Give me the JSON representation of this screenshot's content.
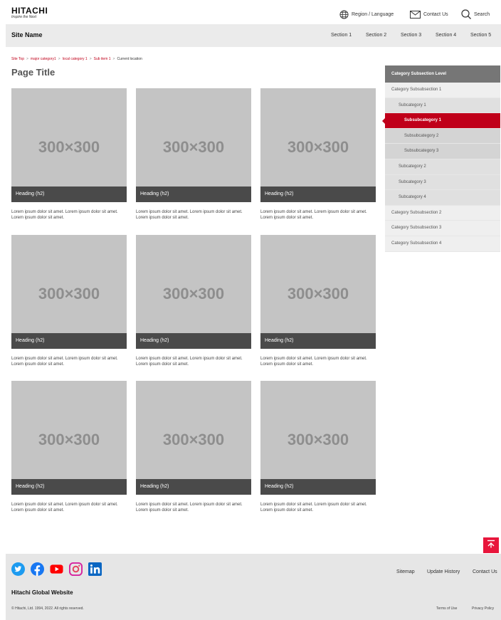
{
  "header": {
    "logo_main": "HITACHI",
    "logo_sub": "Inspire the Next",
    "region_label": "Region / Language",
    "contact_label": "Contact Us",
    "search_label": "Search"
  },
  "sitebar": {
    "site_name": "Site Name",
    "sections": [
      "Section 1",
      "Section 2",
      "Section 3",
      "Section 4",
      "Section 5"
    ]
  },
  "breadcrumb": {
    "items": [
      "Site Top",
      "major category1",
      "local category 1",
      "Sub item 1"
    ],
    "current": "Current location"
  },
  "page": {
    "title": "Page Title",
    "cards": [
      {
        "placeholder": "300×300",
        "heading": "Heading (h2)",
        "text": "Lorem ipsum dolor sit amet. Lorem ipsum dolor sit amet. Lorem ipsum dolor sit amet."
      },
      {
        "placeholder": "300×300",
        "heading": "Heading (h2)",
        "text": "Lorem ipsum dolor sit amet. Lorem ipsum dolor sit amet. Lorem ipsum dolor sit amet."
      },
      {
        "placeholder": "300×300",
        "heading": "Heading (h2)",
        "text": "Lorem ipsum dolor sit amet. Lorem ipsum dolor sit amet. Lorem ipsum dolor sit amet."
      },
      {
        "placeholder": "300×300",
        "heading": "Heading (h2)",
        "text": "Lorem ipsum dolor sit amet. Lorem ipsum dolor sit amet. Lorem ipsum dolor sit amet."
      },
      {
        "placeholder": "300×300",
        "heading": "Heading (h2)",
        "text": "Lorem ipsum dolor sit amet. Lorem ipsum dolor sit amet. Lorem ipsum dolor sit amet."
      },
      {
        "placeholder": "300×300",
        "heading": "Heading (h2)",
        "text": "Lorem ipsum dolor sit amet. Lorem ipsum dolor sit amet. Lorem ipsum dolor sit amet."
      },
      {
        "placeholder": "300×300",
        "heading": "Heading (h2)",
        "text": "Lorem ipsum dolor sit amet. Lorem ipsum dolor sit amet. Lorem ipsum dolor sit amet."
      },
      {
        "placeholder": "300×300",
        "heading": "Heading (h2)",
        "text": "Lorem ipsum dolor sit amet. Lorem ipsum dolor sit amet. Lorem ipsum dolor sit amet."
      },
      {
        "placeholder": "300×300",
        "heading": "Heading (h2)",
        "text": "Lorem ipsum dolor sit amet. Lorem ipsum dolor sit amet. Lorem ipsum dolor sit amet."
      }
    ]
  },
  "sidenav": {
    "heading": "Category Subsection Level",
    "items": [
      {
        "label": "Category Subsubsection 1",
        "level": 1
      },
      {
        "label": "Subcategory 1",
        "level": 2
      },
      {
        "label": "Subsubcategory 1",
        "level": 3,
        "active": true
      },
      {
        "label": "Subsubcategory 2",
        "level": 3
      },
      {
        "label": "Subsubcategory 3",
        "level": 3
      },
      {
        "label": "Subcategory 2",
        "level": 2
      },
      {
        "label": "Subcategory 3",
        "level": 2
      },
      {
        "label": "Subcategory 4",
        "level": 2
      },
      {
        "label": "Category Subsubsection 2",
        "level": 1
      },
      {
        "label": "Category Subsubsection 3",
        "level": 1
      },
      {
        "label": "Category Subsubsection 4",
        "level": 1
      }
    ]
  },
  "footer": {
    "social_icons": [
      "twitter-icon",
      "facebook-icon",
      "youtube-icon",
      "instagram-icon",
      "linkedin-icon"
    ],
    "links": [
      "Sitemap",
      "Update History",
      "Contact Us"
    ],
    "site_name": "Hitachi Global Website",
    "copyright": "© Hitachi, Ltd. 1994, 2022. All rights reserved.",
    "legal_links": [
      "Terms of Use",
      "Privacy Policy"
    ]
  },
  "colors": {
    "brand_red": "#c0001a",
    "totop_red": "#e8163c",
    "card_heading_bg": "#4a4a4a",
    "placeholder_bg": "#c4c4c4"
  }
}
